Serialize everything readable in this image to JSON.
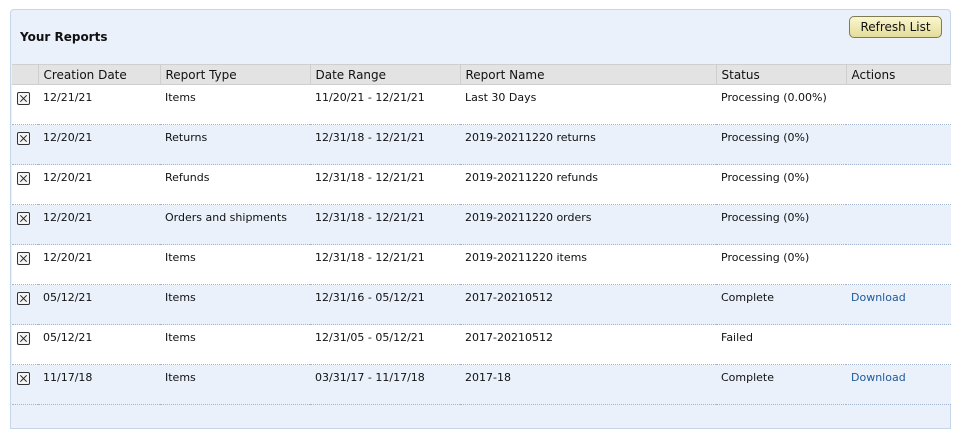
{
  "header": {
    "title": "Your Reports",
    "refresh_label": "Refresh List"
  },
  "columns": {
    "creation_date": "Creation Date",
    "report_type": "Report Type",
    "date_range": "Date Range",
    "report_name": "Report Name",
    "status": "Status",
    "actions": "Actions"
  },
  "rows": [
    {
      "creation_date": "12/21/21",
      "report_type": "Items",
      "date_range": "11/20/21 - 12/21/21",
      "report_name": "Last 30 Days",
      "status": "Processing (0.00%)",
      "action": ""
    },
    {
      "creation_date": "12/20/21",
      "report_type": "Returns",
      "date_range": "12/31/18 - 12/21/21",
      "report_name": "2019-20211220 returns",
      "status": "Processing (0%)",
      "action": ""
    },
    {
      "creation_date": "12/20/21",
      "report_type": "Refunds",
      "date_range": "12/31/18 - 12/21/21",
      "report_name": "2019-20211220 refunds",
      "status": "Processing (0%)",
      "action": ""
    },
    {
      "creation_date": "12/20/21",
      "report_type": "Orders and shipments",
      "date_range": "12/31/18 - 12/21/21",
      "report_name": "2019-20211220 orders",
      "status": "Processing (0%)",
      "action": ""
    },
    {
      "creation_date": "12/20/21",
      "report_type": "Items",
      "date_range": "12/31/18 - 12/21/21",
      "report_name": "2019-20211220 items",
      "status": "Processing (0%)",
      "action": ""
    },
    {
      "creation_date": "05/12/21",
      "report_type": "Items",
      "date_range": "12/31/16 - 05/12/21",
      "report_name": "2017-20210512",
      "status": "Complete",
      "action": "Download"
    },
    {
      "creation_date": "05/12/21",
      "report_type": "Items",
      "date_range": "12/31/05 - 05/12/21",
      "report_name": "2017-20210512",
      "status": "Failed",
      "action": ""
    },
    {
      "creation_date": "11/17/18",
      "report_type": "Items",
      "date_range": "03/31/17 - 11/17/18",
      "report_name": "2017-18",
      "status": "Complete",
      "action": "Download"
    }
  ]
}
